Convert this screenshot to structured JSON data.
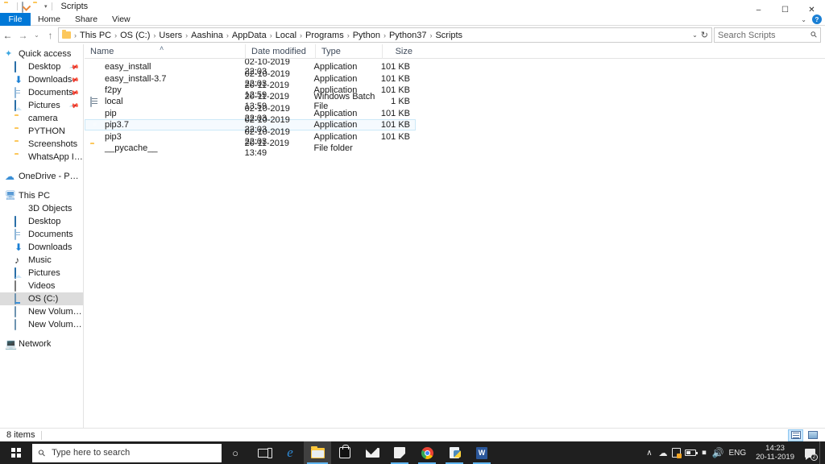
{
  "window": {
    "title": "Scripts",
    "quick_access_toolbar": [
      {
        "name": "folder-icon",
        "label": ""
      },
      {
        "name": "properties-icon",
        "label": ""
      },
      {
        "name": "new-folder-icon",
        "label": ""
      },
      {
        "name": "customize-caret-icon",
        "label": "▾"
      }
    ],
    "controls": {
      "minimize": "–",
      "maximize": "☐",
      "close": "✕"
    },
    "ribbon_collapse": "⌄",
    "help": "?"
  },
  "ribbon": {
    "tabs": [
      {
        "label": "File",
        "active": true
      },
      {
        "label": "Home",
        "active": false
      },
      {
        "label": "Share",
        "active": false
      },
      {
        "label": "View",
        "active": false
      }
    ]
  },
  "address_bar": {
    "back": "←",
    "forward": "→",
    "recent": "⌄",
    "up": "↑",
    "crumbs": [
      "This PC",
      "OS (C:)",
      "Users",
      "Aashina",
      "AppData",
      "Local",
      "Programs",
      "Python",
      "Python37",
      "Scripts"
    ],
    "separator": "›",
    "dropdown": "⌄",
    "refresh": "↻"
  },
  "search": {
    "placeholder": "Search Scripts",
    "icon": "search-icon"
  },
  "sidebar": {
    "groups": [
      {
        "name": "quick-access",
        "root": {
          "label": "Quick access",
          "icon": "star-pin-icon"
        },
        "items": [
          {
            "label": "Desktop",
            "icon": "desktop-icon",
            "pinned": true
          },
          {
            "label": "Downloads",
            "icon": "downloads-icon",
            "pinned": true
          },
          {
            "label": "Documents",
            "icon": "documents-icon",
            "pinned": true
          },
          {
            "label": "Pictures",
            "icon": "pictures-icon",
            "pinned": true
          },
          {
            "label": "camera",
            "icon": "folder-icon",
            "pinned": false
          },
          {
            "label": "PYTHON",
            "icon": "folder-icon",
            "pinned": false
          },
          {
            "label": "Screenshots",
            "icon": "folder-icon",
            "pinned": false
          },
          {
            "label": "WhatsApp Images",
            "icon": "folder-icon",
            "pinned": false
          }
        ]
      },
      {
        "name": "onedrive",
        "root": {
          "label": "OneDrive - Personal",
          "icon": "cloud-icon"
        },
        "items": []
      },
      {
        "name": "this-pc",
        "root": {
          "label": "This PC",
          "icon": "pc-icon"
        },
        "items": [
          {
            "label": "3D Objects",
            "icon": "3d-objects-icon",
            "pinned": false
          },
          {
            "label": "Desktop",
            "icon": "desktop-icon",
            "pinned": false
          },
          {
            "label": "Documents",
            "icon": "documents-icon",
            "pinned": false
          },
          {
            "label": "Downloads",
            "icon": "downloads-icon",
            "pinned": false
          },
          {
            "label": "Music",
            "icon": "music-icon",
            "pinned": false
          },
          {
            "label": "Pictures",
            "icon": "pictures-icon",
            "pinned": false
          },
          {
            "label": "Videos",
            "icon": "videos-icon",
            "pinned": false
          },
          {
            "label": "OS (C:)",
            "icon": "drive-icon",
            "pinned": false,
            "selected": true
          },
          {
            "label": "New Volume (E:)",
            "icon": "drive-icon",
            "pinned": false
          },
          {
            "label": "New Volume (F:)",
            "icon": "drive-icon",
            "pinned": false
          }
        ]
      },
      {
        "name": "network",
        "root": {
          "label": "Network",
          "icon": "network-icon"
        },
        "items": []
      }
    ]
  },
  "file_list": {
    "columns": [
      {
        "key": "name",
        "label": "Name",
        "sorted": "asc"
      },
      {
        "key": "date",
        "label": "Date modified"
      },
      {
        "key": "type",
        "label": "Type"
      },
      {
        "key": "size",
        "label": "Size"
      }
    ],
    "sort_caret": "˄",
    "rows": [
      {
        "name": "easy_install",
        "date": "02-10-2019 22:03",
        "type": "Application",
        "size": "101 KB",
        "icon": "python-app-icon",
        "hovered": false
      },
      {
        "name": "easy_install-3.7",
        "date": "02-10-2019 22:03",
        "type": "Application",
        "size": "101 KB",
        "icon": "python-app-icon",
        "hovered": false
      },
      {
        "name": "f2py",
        "date": "20-11-2019 12:59",
        "type": "Application",
        "size": "101 KB",
        "icon": "python-app-icon",
        "hovered": false
      },
      {
        "name": "local",
        "date": "20-11-2019 13:59",
        "type": "Windows Batch File",
        "size": "1 KB",
        "icon": "batch-file-icon",
        "hovered": false
      },
      {
        "name": "pip",
        "date": "02-10-2019 22:03",
        "type": "Application",
        "size": "101 KB",
        "icon": "python-app-icon",
        "hovered": false
      },
      {
        "name": "pip3.7",
        "date": "02-10-2019 22:03",
        "type": "Application",
        "size": "101 KB",
        "icon": "python-app-icon",
        "hovered": true
      },
      {
        "name": "pip3",
        "date": "02-10-2019 22:03",
        "type": "Application",
        "size": "101 KB",
        "icon": "python-app-icon",
        "hovered": false
      },
      {
        "name": "__pycache__",
        "date": "20-11-2019 13:49",
        "type": "File folder",
        "size": "",
        "icon": "folder-icon",
        "hovered": false
      }
    ]
  },
  "status_bar": {
    "item_count": "8 items",
    "views": [
      {
        "name": "details-view-button",
        "active": true
      },
      {
        "name": "large-icons-view-button",
        "active": false
      }
    ]
  },
  "taskbar": {
    "start": "start-button",
    "search_placeholder": "Type here to search",
    "cortana": "○",
    "apps": [
      {
        "name": "task-view-button",
        "icon": "task-view-icon",
        "state": "idle"
      },
      {
        "name": "edge-button",
        "icon": "edge-icon",
        "state": "idle"
      },
      {
        "name": "file-explorer-button",
        "icon": "file-explorer-icon",
        "state": "active"
      },
      {
        "name": "microsoft-store-button",
        "icon": "store-icon",
        "state": "idle"
      },
      {
        "name": "mail-button",
        "icon": "mail-icon",
        "state": "idle"
      },
      {
        "name": "sticky-notes-button",
        "icon": "sticky-notes-icon",
        "state": "running"
      },
      {
        "name": "chrome-button",
        "icon": "chrome-icon",
        "state": "running"
      },
      {
        "name": "python-idle-button",
        "icon": "python-doc-icon",
        "state": "running"
      },
      {
        "name": "word-button",
        "icon": "word-icon",
        "state": "running"
      }
    ],
    "tray": {
      "chevron": "∧",
      "onedrive": "☁",
      "security": "security-icon",
      "battery": "battery-icon",
      "wifi": "◠",
      "volume": "🔊",
      "language": "ENG",
      "time": "14:23",
      "date": "20-11-2019",
      "notification_count": "2"
    }
  }
}
